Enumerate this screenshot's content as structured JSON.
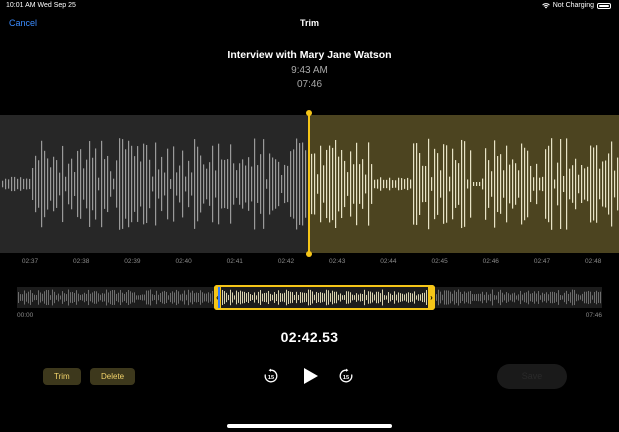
{
  "status": {
    "time": "10:01 AM   Wed Sep 25",
    "charging": "Not Charging"
  },
  "nav": {
    "cancel": "Cancel",
    "title": "Trim"
  },
  "recording": {
    "name": "Interview with Mary Jane Watson",
    "time": "9:43 AM",
    "duration": "07:46"
  },
  "timeline_ticks": [
    "02:37",
    "02:38",
    "02:39",
    "02:40",
    "02:41",
    "02:42",
    "02:43",
    "02:44",
    "02:45",
    "02:46",
    "02:47",
    "02:48"
  ],
  "overview": {
    "start": "00:00",
    "end": "07:46"
  },
  "position": "02:42.53",
  "actions": {
    "trim": "Trim",
    "delete": "Delete",
    "save": "Save"
  },
  "colors": {
    "accent": "#f5c518",
    "link": "#3b8cff",
    "playhead_mini": "#2f7cff"
  },
  "icons": {
    "skip_back": "gobackward-15-icon",
    "play": "play-icon",
    "skip_forward": "goforward-15-icon"
  }
}
